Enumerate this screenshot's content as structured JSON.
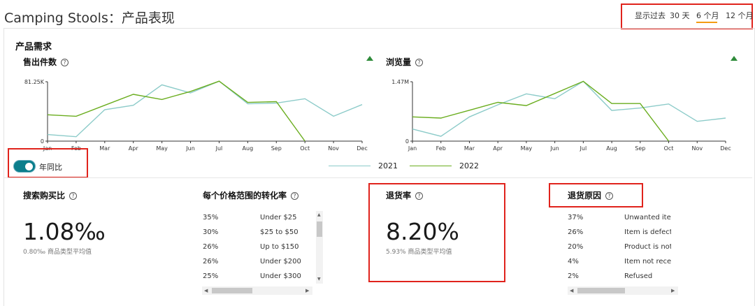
{
  "page": {
    "title": "Camping Stools：产品表现",
    "range_label": "显示过去",
    "range_options": [
      "30 天",
      "6 个月",
      "12 个月"
    ],
    "selected_range": "6 个月"
  },
  "demand": {
    "section_title": "产品需求",
    "units_title": "售出件数",
    "views_title": "浏览量",
    "help_glyph": "?"
  },
  "toggle": {
    "label": "年同比",
    "on": true
  },
  "legend": [
    {
      "name": "2021",
      "color": "#8ccbc9"
    },
    {
      "name": "2022",
      "color": "#6aad1e"
    }
  ],
  "chart_data": [
    {
      "type": "line",
      "title": "售出件数",
      "categories": [
        "Jan",
        "Feb",
        "Mar",
        "Apr",
        "May",
        "Jun",
        "Jul",
        "Aug",
        "Sep",
        "Oct",
        "Nov",
        "Dec"
      ],
      "y_ticks": [
        "81.25K",
        "0"
      ],
      "ylim": [
        0,
        81250
      ],
      "series": [
        {
          "name": "2021",
          "values": [
            9000,
            6000,
            43000,
            49000,
            77000,
            66000,
            82000,
            51000,
            52000,
            58000,
            34000,
            50000
          ]
        },
        {
          "name": "2022",
          "values": [
            36000,
            34000,
            null,
            64000,
            57000,
            68000,
            82000,
            53000,
            54000,
            0,
            null,
            null
          ]
        }
      ]
    },
    {
      "type": "line",
      "title": "浏览量",
      "categories": [
        "Jan",
        "Feb",
        "Mar",
        "Apr",
        "May",
        "Jun",
        "Jul",
        "Aug",
        "Sep",
        "Oct",
        "Nov",
        "Dec"
      ],
      "y_ticks": [
        "1.47M",
        "0"
      ],
      "ylim": [
        0,
        1470000
      ],
      "series": [
        {
          "name": "2021",
          "values": [
            300000,
            120000,
            600000,
            900000,
            1170000,
            1050000,
            1480000,
            760000,
            820000,
            920000,
            490000,
            570000
          ]
        },
        {
          "name": "2022",
          "values": [
            600000,
            570000,
            null,
            960000,
            880000,
            1180000,
            1480000,
            930000,
            930000,
            0,
            null,
            null
          ]
        }
      ]
    }
  ],
  "metrics": {
    "conversion": {
      "title": "搜索购买比",
      "value": "1.08‰",
      "avg": "0.80‰ 商品类型平均值"
    },
    "price_rate": {
      "title": "每个价格范围的转化率",
      "rows": [
        {
          "pct": "35%",
          "label": "Under $25"
        },
        {
          "pct": "30%",
          "label": "$25 to $50"
        },
        {
          "pct": "26%",
          "label": "Up to $150"
        },
        {
          "pct": "26%",
          "label": "Under $200"
        },
        {
          "pct": "25%",
          "label": "Under $300"
        }
      ]
    },
    "return_rate": {
      "title": "退货率",
      "value": "8.20%",
      "avg": "5.93% 商品类型平均值"
    },
    "return_reasons": {
      "title": "退货原因",
      "rows": [
        {
          "pct": "37%",
          "label": "Unwanted item"
        },
        {
          "pct": "26%",
          "label": "Item is defective"
        },
        {
          "pct": "20%",
          "label": "Product is not as d"
        },
        {
          "pct": "4%",
          "label": "Item not received b"
        },
        {
          "pct": "2%",
          "label": "Refused"
        }
      ]
    }
  }
}
